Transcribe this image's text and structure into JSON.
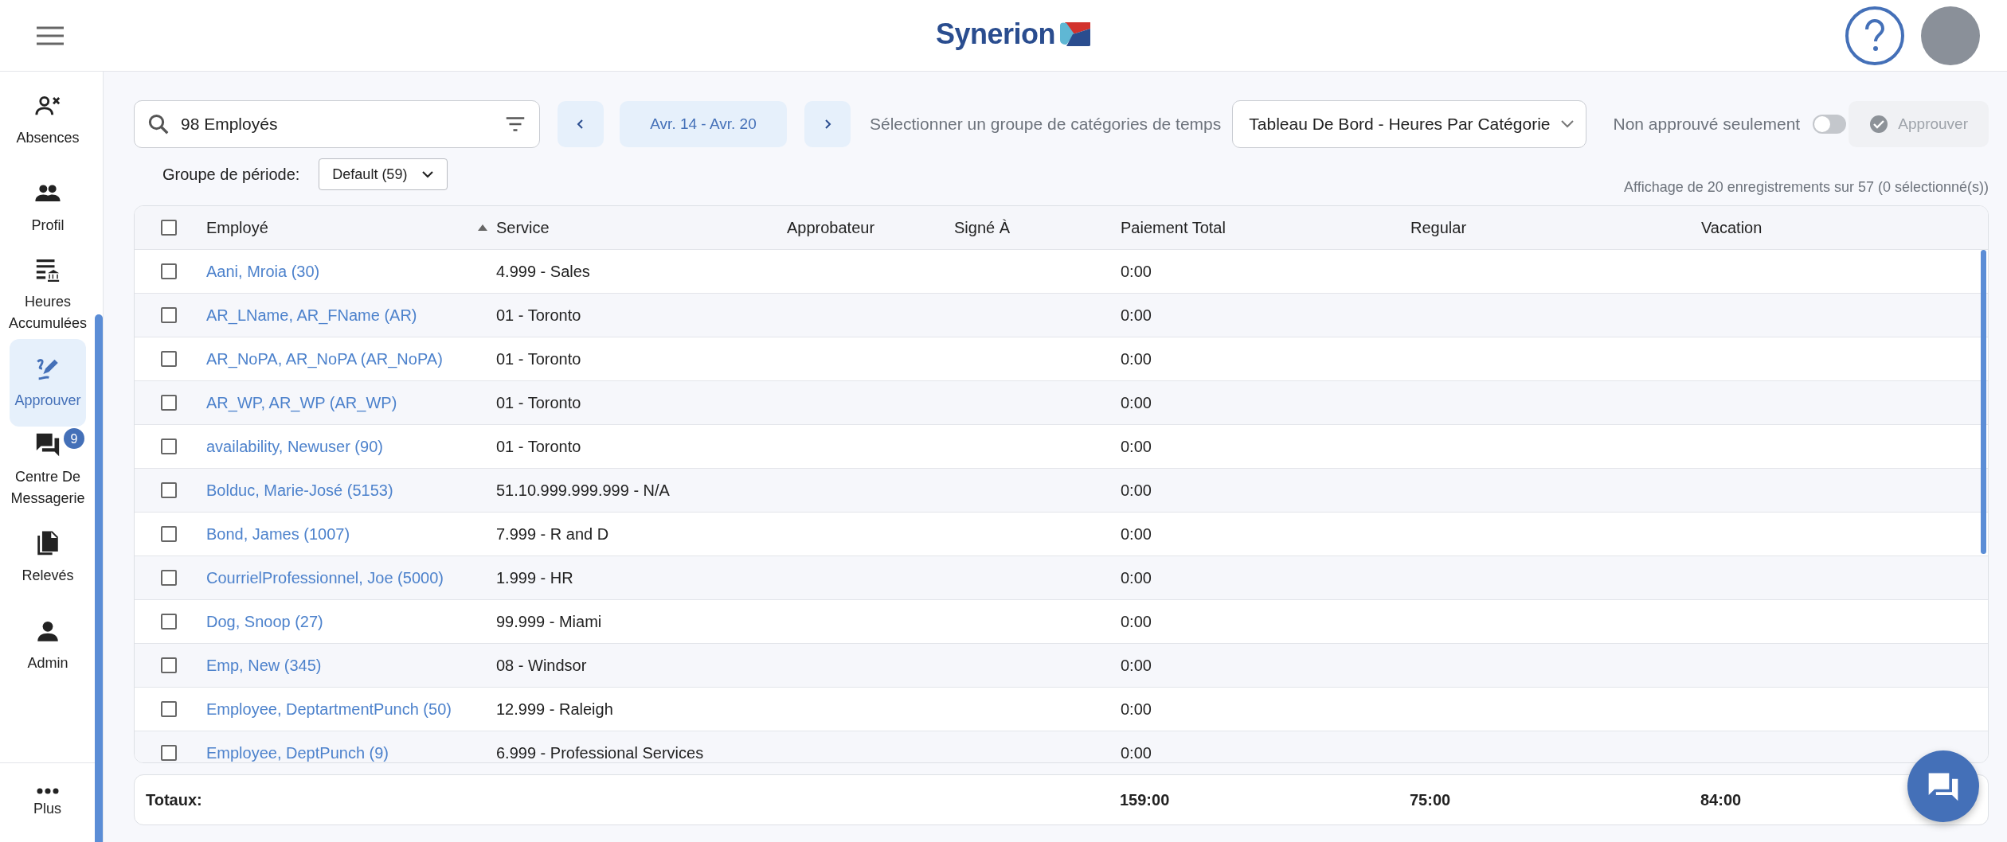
{
  "top_bar": {
    "logo": "Synerion"
  },
  "sidebar": {
    "items": [
      {
        "kind": "absences",
        "label": "Absences",
        "selected": false
      },
      {
        "kind": "profile",
        "label": "Profil",
        "selected": false
      },
      {
        "kind": "hours",
        "label": "Heures Accumulées",
        "selected": false
      },
      {
        "kind": "approve",
        "label": "Approuver",
        "selected": true
      },
      {
        "kind": "messages",
        "label": "Centre De Messagerie",
        "selected": false,
        "badge": "9"
      },
      {
        "kind": "statements",
        "label": "Relevés",
        "selected": false
      },
      {
        "kind": "admin",
        "label": "Admin",
        "selected": false
      }
    ],
    "more": {
      "label": "Plus"
    }
  },
  "toolbar": {
    "search": {
      "value": "98 Employés"
    },
    "date_range": "Avr. 14 - Avr. 20",
    "category_label": "Sélectionner un groupe de catégories de temps",
    "category_select": "Tableau De Bord - Heures Par Catégorie",
    "unapproved_only": {
      "label": "Non approuvé seulement",
      "on": false
    },
    "approve_button": {
      "label": "Approuver",
      "disabled": true
    }
  },
  "period_group": {
    "label": "Groupe de période:",
    "value": "Default (59)"
  },
  "record_count": "Affichage de 20 enregistrements sur 57 (0 sélectionné(s))",
  "table": {
    "all_checked": false,
    "columns": [
      {
        "label": "Employé",
        "sorted": true
      },
      {
        "label": "Service",
        "sorted": false
      },
      {
        "label": "Approbateur",
        "sorted": false
      },
      {
        "label": "Signé À",
        "sorted": false
      },
      {
        "label": "Paiement Total",
        "sorted": false
      },
      {
        "label": "Regular",
        "sorted": false
      },
      {
        "label": "Vacation",
        "sorted": false
      }
    ],
    "rows": [
      {
        "checked": false,
        "employee": "Aani, Mroia (30)",
        "service": "4.999 - Sales",
        "total_pay": "0:00"
      },
      {
        "checked": false,
        "employee": "AR_LName, AR_FName (AR)",
        "service": "01 - Toronto",
        "total_pay": "0:00"
      },
      {
        "checked": false,
        "employee": "AR_NoPA, AR_NoPA (AR_NoPA)",
        "service": "01 - Toronto",
        "total_pay": "0:00"
      },
      {
        "checked": false,
        "employee": "AR_WP, AR_WP (AR_WP)",
        "service": "01 - Toronto",
        "total_pay": "0:00"
      },
      {
        "checked": false,
        "employee": "availability, Newuser (90)",
        "service": "01 - Toronto",
        "total_pay": "0:00"
      },
      {
        "checked": false,
        "employee": "Bolduc, Marie-José (5153)",
        "service": "51.10.999.999.999 - N/A",
        "total_pay": "0:00"
      },
      {
        "checked": false,
        "employee": "Bond, James (1007)",
        "service": "7.999 - R and D",
        "total_pay": "0:00"
      },
      {
        "checked": false,
        "employee": "CourrielProfessionnel, Joe (5000)",
        "service": "1.999 - HR",
        "total_pay": "0:00"
      },
      {
        "checked": false,
        "employee": "Dog, Snoop (27)",
        "service": "99.999 - Miami",
        "total_pay": "0:00"
      },
      {
        "checked": false,
        "employee": "Emp, New (345)",
        "service": "08 - Windsor",
        "total_pay": "0:00"
      },
      {
        "checked": false,
        "employee": "Employee, DeptartmentPunch (50)",
        "service": "12.999 - Raleigh",
        "total_pay": "0:00"
      },
      {
        "checked": false,
        "employee": "Employee, DeptPunch (9)",
        "service": "6.999 - Professional Services",
        "total_pay": "0:00"
      }
    ],
    "totals": {
      "label": "Totaux:",
      "total_pay": "159:00",
      "regular": "75:00",
      "vacation": "84:00"
    }
  }
}
